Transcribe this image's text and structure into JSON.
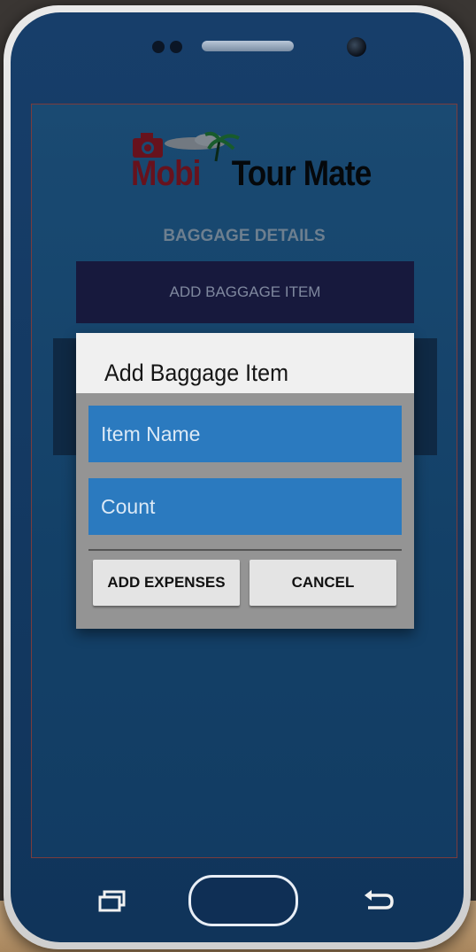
{
  "app": {
    "logo": {
      "word1": "Mobi",
      "word2": "Tour Mate"
    },
    "screen_title": "BAGGAGE DETAILS",
    "add_button_label": "ADD BAGGAGE ITEM"
  },
  "dialog": {
    "title": "Add Baggage Item",
    "item_name": {
      "value": "",
      "placeholder": "Item Name"
    },
    "count": {
      "value": "",
      "placeholder": "Count"
    },
    "add_expenses_label": "ADD EXPENSES",
    "cancel_label": "CANCEL"
  },
  "nav": {
    "recent_icon": "recent-apps-icon",
    "home_icon": "home-button",
    "back_icon": "back-icon"
  },
  "colors": {
    "screen_bg": "#1f5683",
    "button_bg": "#1c1a43",
    "input_bg": "#2b7abf",
    "logo_red": "#7d121b"
  }
}
